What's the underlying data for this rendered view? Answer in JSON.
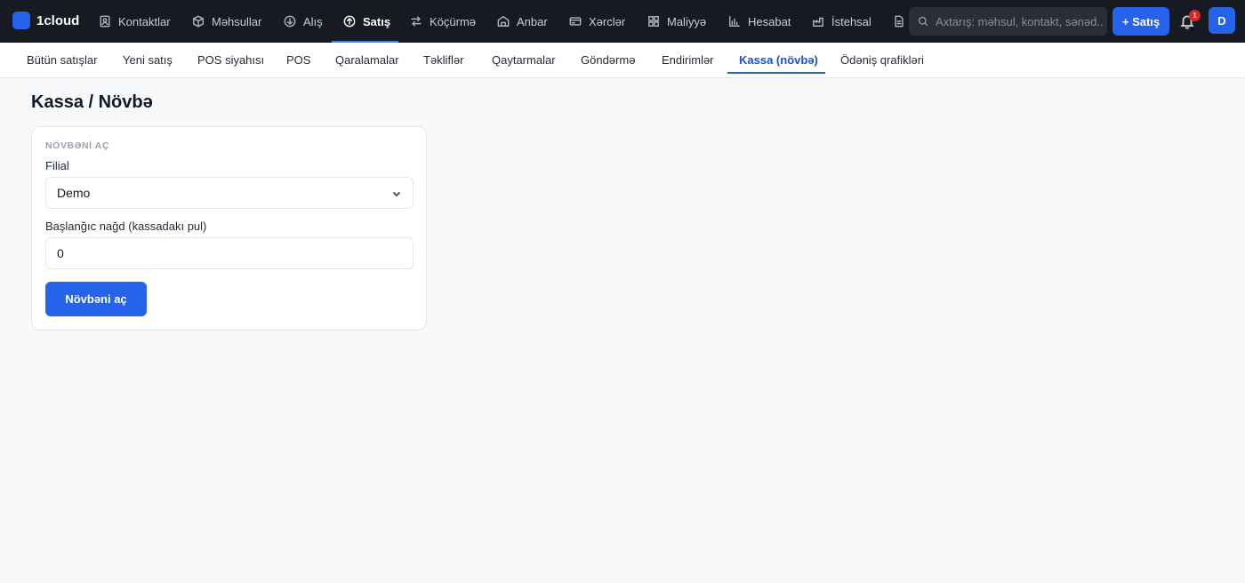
{
  "app": {
    "name": "1cloud"
  },
  "topnav": {
    "items": [
      {
        "label": "Kontaktlar",
        "icon": "contacts-icon"
      },
      {
        "label": "Məhsullar",
        "icon": "box-icon"
      },
      {
        "label": "Alış",
        "icon": "arrow-down-circle-icon"
      },
      {
        "label": "Satış",
        "icon": "arrow-up-circle-icon",
        "active": true
      },
      {
        "label": "Köçürmə",
        "icon": "transfer-icon"
      },
      {
        "label": "Anbar",
        "icon": "warehouse-icon"
      },
      {
        "label": "Xərclər",
        "icon": "expense-icon"
      },
      {
        "label": "Maliyyə",
        "icon": "finance-icon"
      },
      {
        "label": "Hesabat",
        "icon": "bar-chart-icon"
      },
      {
        "label": "İstehsal",
        "icon": "production-icon"
      }
    ],
    "search_placeholder": "Axtarış: məhsul, kontakt, sənəd...",
    "new_sale_label": "+ Satış",
    "notification_count": "1",
    "avatar_initial": "D",
    "accent": "#2563eb"
  },
  "subnav": {
    "items": [
      {
        "label": "Bütün satışlar"
      },
      {
        "label": "Yeni satış"
      },
      {
        "label": "POS siyahısı"
      },
      {
        "label": "POS"
      },
      {
        "label": "Qaralamalar"
      },
      {
        "label": "Təkliflər"
      },
      {
        "label": "Qaytarmalar"
      },
      {
        "label": "Göndərmə"
      },
      {
        "label": "Endirimlər"
      },
      {
        "label": "Kassa (növbə)",
        "active": true
      },
      {
        "label": "Ödəniş qrafikləri"
      }
    ]
  },
  "page": {
    "title": "Kassa / Növbə",
    "card": {
      "section_label": "NÖVBƏNİ AÇ",
      "branch_label": "Filial",
      "branch_value": "Demo",
      "cash_label": "Başlanğıc nağd (kassadakı pul)",
      "cash_value": "0",
      "submit_label": "Növbəni aç"
    }
  }
}
